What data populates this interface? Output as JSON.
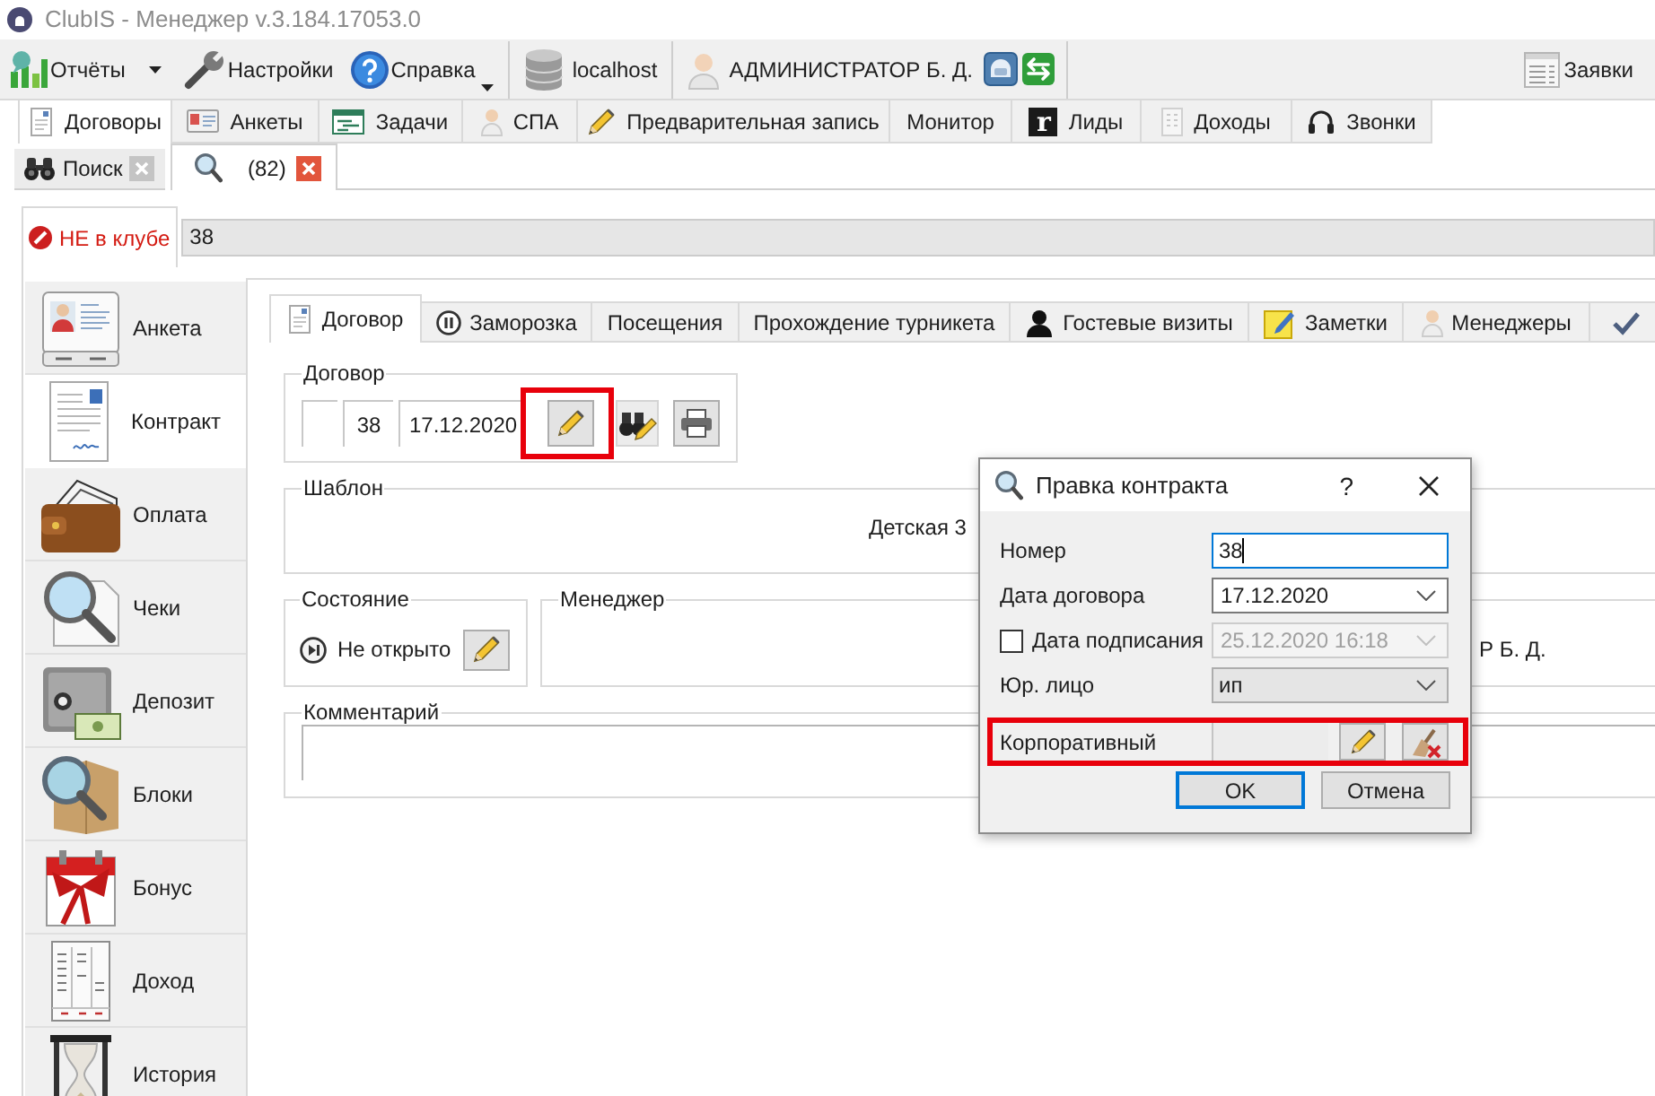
{
  "window": {
    "title": "ClubIS - Менеджер v.3.184.17053.0"
  },
  "toolbar": {
    "groups": [
      {
        "items": [
          {
            "kind": "split",
            "label": "Отчёты"
          },
          {
            "kind": "plain",
            "label": "Настройки"
          },
          {
            "kind": "menu",
            "label": "Справка"
          }
        ]
      },
      {
        "items": [
          {
            "kind": "plain",
            "label": "localhost"
          }
        ]
      },
      {
        "items": [
          {
            "kind": "plain",
            "label": "АДМИНИСТРАТОР Б. Д."
          }
        ]
      }
    ],
    "requests": {
      "label": "Заявки"
    }
  },
  "module_tabs": [
    {
      "label": "Договоры",
      "selected": true
    },
    {
      "label": "Анкеты",
      "selected": false
    },
    {
      "label": "Задачи",
      "selected": false
    },
    {
      "label": "СПА",
      "selected": false
    },
    {
      "label": "Предварительная запись",
      "selected": false
    },
    {
      "label": "Монитор",
      "selected": false
    },
    {
      "label": "Лиды",
      "badge": "r",
      "selected": false
    },
    {
      "label": "Доходы",
      "selected": false
    },
    {
      "label": "Звонки",
      "selected": false
    }
  ],
  "document_tabs": [
    {
      "label": "Поиск",
      "selected": false
    },
    {
      "label": "(82)",
      "selected": true
    }
  ],
  "client_bar": {
    "status": "НЕ в клубе",
    "in_club": false,
    "value": "38"
  },
  "sidebar": {
    "items": [
      {
        "label": "Анкета",
        "selected": false
      },
      {
        "label": "Контракт",
        "selected": true
      },
      {
        "label": "Оплата",
        "selected": false
      },
      {
        "label": "Чеки",
        "selected": false
      },
      {
        "label": "Депозит",
        "selected": false
      },
      {
        "label": "Блоки",
        "selected": false
      },
      {
        "label": "Бонус",
        "selected": false
      },
      {
        "label": "Доход",
        "selected": false
      },
      {
        "label": "История",
        "selected": false
      }
    ]
  },
  "contract_tabs": [
    {
      "label": "Договор",
      "selected": true
    },
    {
      "label": "Заморозка",
      "selected": false
    },
    {
      "label": "Посещения",
      "selected": false
    },
    {
      "label": "Прохождение турникета",
      "selected": false
    },
    {
      "label": "Гостевые визиты",
      "selected": false
    },
    {
      "label": "Заметки",
      "selected": false
    },
    {
      "label": "Менеджеры",
      "selected": false
    },
    {
      "selected": false
    }
  ],
  "contract": {
    "title": "Договор",
    "number": "38",
    "date": "17.12.2020",
    "edit_highlighted": true
  },
  "template": {
    "title": "Шаблон",
    "value": "Детская 3"
  },
  "state": {
    "title": "Состояние",
    "value": "Не открыто"
  },
  "manager": {
    "title": "Менеджер",
    "value": "Р Б. Д."
  },
  "comment": {
    "title": "Комментарий"
  },
  "dialog": {
    "title": "Правка контракта",
    "help": "?",
    "fields": [
      {
        "kind": "text",
        "label": "Номер",
        "value": "38",
        "focused": true
      },
      {
        "kind": "date",
        "label": "Дата договора",
        "value": "17.12.2020"
      },
      {
        "kind": "checked_date",
        "label": "Дата подписания",
        "value": "25.12.2020 16:18",
        "checked": false,
        "disabled": true
      },
      {
        "kind": "select",
        "label": "Юр. лицо",
        "value": "ип"
      },
      {
        "kind": "picker",
        "label": "Корпоративный",
        "highlighted": true
      }
    ],
    "buttons": [
      {
        "label": "OK",
        "default": true
      },
      {
        "label": "Отмена",
        "default": false
      }
    ]
  }
}
